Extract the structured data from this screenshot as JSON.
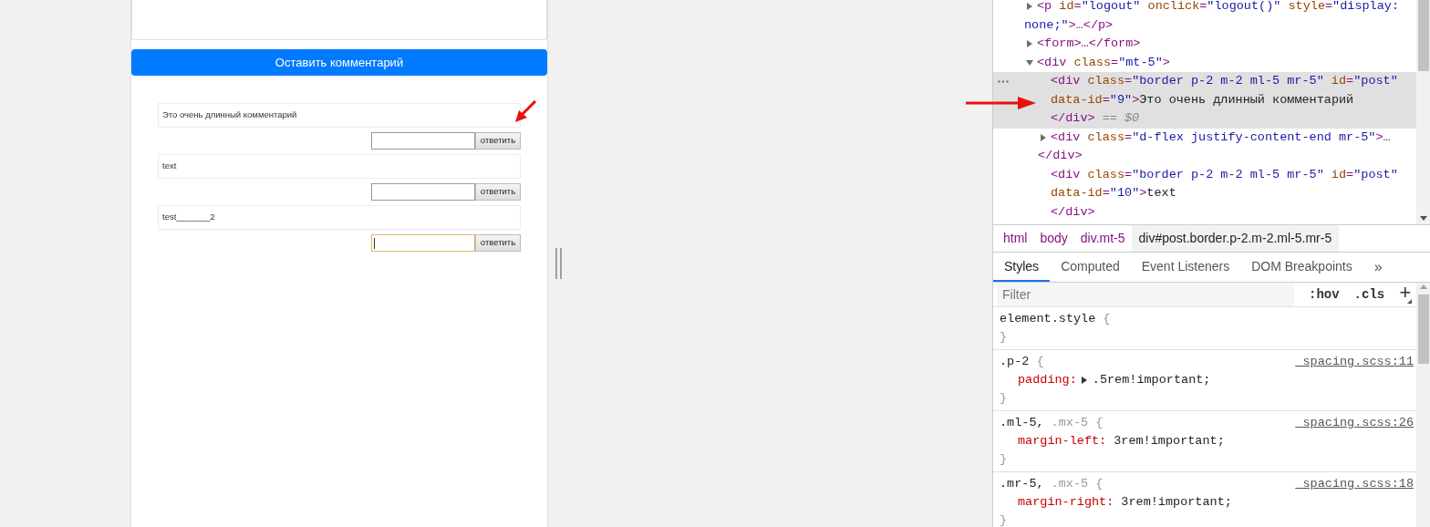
{
  "page": {
    "submit_button": "Оставить комментарий",
    "comments": [
      {
        "text": "Это очень длинный комментарий",
        "reply_button": "ответить",
        "reply_focused": false
      },
      {
        "text": "text",
        "reply_button": "ответить",
        "reply_focused": false
      },
      {
        "text": "test_______2",
        "reply_button": "ответить",
        "reply_focused": true
      }
    ]
  },
  "devtools": {
    "elements": [
      {
        "expanded": false,
        "selected": false,
        "lines": [
          [
            {
              "kind": "tag",
              "text": "<p"
            },
            {
              "kind": "attr",
              "text": " id"
            },
            {
              "kind": "tag",
              "text": "="
            },
            {
              "kind": "value",
              "text": "\"logout\""
            },
            {
              "kind": "attr",
              "text": " onclick"
            },
            {
              "kind": "tag",
              "text": "="
            },
            {
              "kind": "value",
              "text": "\"logout()\""
            },
            {
              "kind": "attr",
              "text": " style"
            },
            {
              "kind": "tag",
              "text": "="
            },
            {
              "kind": "value",
              "text": "\"display:"
            }
          ],
          [
            {
              "kind": "value",
              "text": "none;\""
            },
            {
              "kind": "tag",
              "text": ">…</p>"
            }
          ]
        ]
      },
      {
        "expanded": false,
        "selected": false,
        "lines": [
          [
            {
              "kind": "tag",
              "text": "<form>…</form>"
            }
          ]
        ]
      },
      {
        "expanded": true,
        "selected": false,
        "lines": [
          [
            {
              "kind": "tag",
              "text": "<div"
            },
            {
              "kind": "attr",
              "text": " class"
            },
            {
              "kind": "tag",
              "text": "="
            },
            {
              "kind": "value",
              "text": "\"mt-5\""
            },
            {
              "kind": "tag",
              "text": ">"
            }
          ]
        ],
        "children": [
          {
            "selected": true,
            "lines": [
              [
                {
                  "kind": "tag",
                  "text": "<div"
                },
                {
                  "kind": "attr",
                  "text": " class"
                },
                {
                  "kind": "tag",
                  "text": "="
                },
                {
                  "kind": "value",
                  "text": "\"border p-2 m-2 ml-5 mr-5\""
                },
                {
                  "kind": "attr",
                  "text": " id"
                },
                {
                  "kind": "tag",
                  "text": "="
                },
                {
                  "kind": "value",
                  "text": "\"post\""
                }
              ],
              [
                {
                  "kind": "attr",
                  "text": "data-id"
                },
                {
                  "kind": "tag",
                  "text": "="
                },
                {
                  "kind": "value",
                  "text": "\"9\""
                },
                {
                  "kind": "tag",
                  "text": ">"
                },
                {
                  "kind": "text",
                  "text": "Это очень длинный комментарий"
                }
              ],
              [
                {
                  "kind": "tag",
                  "text": "</div>"
                },
                {
                  "kind": "marker",
                  "text": " == $0"
                }
              ]
            ]
          },
          {
            "expanded": false,
            "selected": false,
            "lines": [
              [
                {
                  "kind": "tag",
                  "text": "<div"
                },
                {
                  "kind": "attr",
                  "text": " class"
                },
                {
                  "kind": "tag",
                  "text": "="
                },
                {
                  "kind": "value",
                  "text": "\"d-flex justify-content-end mr-5\""
                },
                {
                  "kind": "tag",
                  "text": ">…"
                }
              ],
              [
                {
                  "kind": "tag",
                  "text": "</div>"
                }
              ]
            ]
          },
          {
            "selected": false,
            "lines": [
              [
                {
                  "kind": "tag",
                  "text": "<div"
                },
                {
                  "kind": "attr",
                  "text": " class"
                },
                {
                  "kind": "tag",
                  "text": "="
                },
                {
                  "kind": "value",
                  "text": "\"border p-2 m-2 ml-5 mr-5\""
                },
                {
                  "kind": "attr",
                  "text": " id"
                },
                {
                  "kind": "tag",
                  "text": "="
                },
                {
                  "kind": "value",
                  "text": "\"post\""
                }
              ],
              [
                {
                  "kind": "attr",
                  "text": "data-id"
                },
                {
                  "kind": "tag",
                  "text": "="
                },
                {
                  "kind": "value",
                  "text": "\"10\""
                },
                {
                  "kind": "tag",
                  "text": ">"
                },
                {
                  "kind": "text",
                  "text": "text"
                }
              ],
              [
                {
                  "kind": "tag",
                  "text": "</div>"
                }
              ]
            ]
          }
        ]
      }
    ],
    "breadcrumbs": [
      {
        "label": "html",
        "selected": false
      },
      {
        "label": "body",
        "selected": false
      },
      {
        "label": "div.mt-5",
        "selected": false
      },
      {
        "label": "div#post.border.p-2.m-2.ml-5.mr-5",
        "selected": true
      }
    ],
    "tabs": [
      {
        "label": "Styles",
        "selected": true
      },
      {
        "label": "Computed",
        "selected": false
      },
      {
        "label": "Event Listeners",
        "selected": false
      },
      {
        "label": "DOM Breakpoints",
        "selected": false
      }
    ],
    "more_tabs": "»",
    "filter": {
      "placeholder": "Filter"
    },
    "toolbar": [
      ":hov",
      ".cls",
      "+"
    ],
    "rules": [
      {
        "selectors": [
          {
            "text": "element.style",
            "matched": true
          }
        ],
        "open": "{",
        "close": "}"
      },
      {
        "selectors": [
          {
            "text": ".p-2",
            "matched": true
          }
        ],
        "open": "{",
        "close": "}",
        "source": "_spacing.scss:11",
        "properties": [
          {
            "name": "padding",
            "colon": ":",
            "value": ".5rem!important;",
            "expandable": true
          }
        ]
      },
      {
        "selectors": [
          {
            "text": ".ml-5,",
            "matched": true
          },
          {
            "text": ".mx-5",
            "matched": false
          }
        ],
        "open": "{",
        "close": "}",
        "source": "_spacing.scss:26",
        "properties": [
          {
            "name": "margin-left",
            "colon": ":",
            "value": "3rem!important;",
            "expandable": false
          }
        ]
      },
      {
        "selectors": [
          {
            "text": ".mr-5,",
            "matched": true
          },
          {
            "text": ".mx-5",
            "matched": false
          }
        ],
        "open": "{",
        "close": "}",
        "source": "_spacing.scss:18",
        "properties": [
          {
            "name": "margin-right",
            "colon": ":",
            "value": "3rem!important;",
            "expandable": false
          }
        ]
      }
    ]
  }
}
